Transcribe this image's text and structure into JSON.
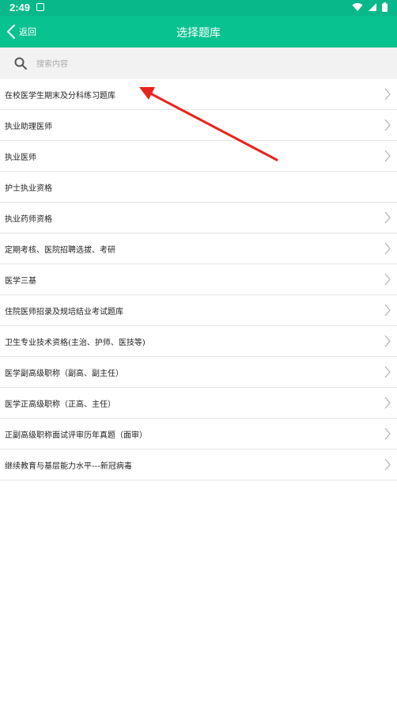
{
  "status_bar": {
    "time": "2:49",
    "icons": [
      "app-notification-icon",
      "wifi-icon",
      "signal-icon",
      "battery-icon"
    ]
  },
  "header": {
    "back_label": "返回",
    "title": "选择题库",
    "background": "#08c28f"
  },
  "search": {
    "placeholder": "搜索内容",
    "value": ""
  },
  "items": [
    {
      "label": "在校医学生期末及分科练习题库",
      "chevron": true
    },
    {
      "label": "执业助理医师",
      "chevron": true
    },
    {
      "label": "执业医师",
      "chevron": true
    },
    {
      "label": "护士执业资格",
      "chevron": false
    },
    {
      "label": "执业药师资格",
      "chevron": true
    },
    {
      "label": "定期考核、医院招聘选拔、考研",
      "chevron": true
    },
    {
      "label": "医学三基",
      "chevron": true
    },
    {
      "label": "住院医师招录及规培结业考试题库",
      "chevron": true
    },
    {
      "label": "卫生专业技术资格(主治、护师、医技等)",
      "chevron": true
    },
    {
      "label": "医学副高级职称（副高、副主任）",
      "chevron": true
    },
    {
      "label": "医学正高级职称（正高、主任）",
      "chevron": true
    },
    {
      "label": "正副高级职称面试评审历年真题（面审）",
      "chevron": true
    },
    {
      "label": "继续教育与基层能力水平---新冠病毒",
      "chevron": true
    }
  ],
  "colors": {
    "accent": "#08c28f",
    "annotation": "#e8241c"
  }
}
